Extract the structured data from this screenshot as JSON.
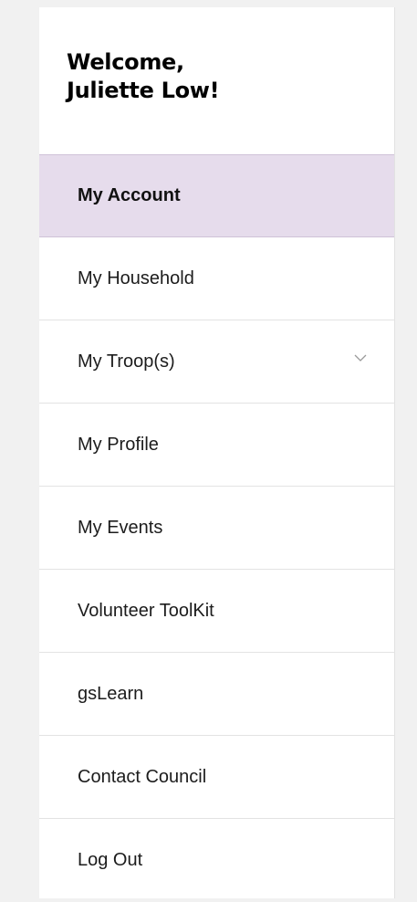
{
  "greeting": {
    "line1": "Welcome,",
    "line2": "Juliette Low!"
  },
  "menu": {
    "items": [
      {
        "label": "My Account",
        "active": true
      },
      {
        "label": "My Household"
      },
      {
        "label": "My Troop(s)",
        "expandable": true,
        "icon": "chevron-down-icon"
      },
      {
        "label": "My Profile"
      },
      {
        "label": "My Events"
      },
      {
        "label": "Volunteer ToolKit"
      },
      {
        "label": "gsLearn"
      },
      {
        "label": "Contact Council"
      },
      {
        "label": "Log Out"
      }
    ]
  },
  "colors": {
    "active_background": "#e6dcec",
    "text": "#1c1c1c",
    "divider": "#e3e3e3"
  }
}
